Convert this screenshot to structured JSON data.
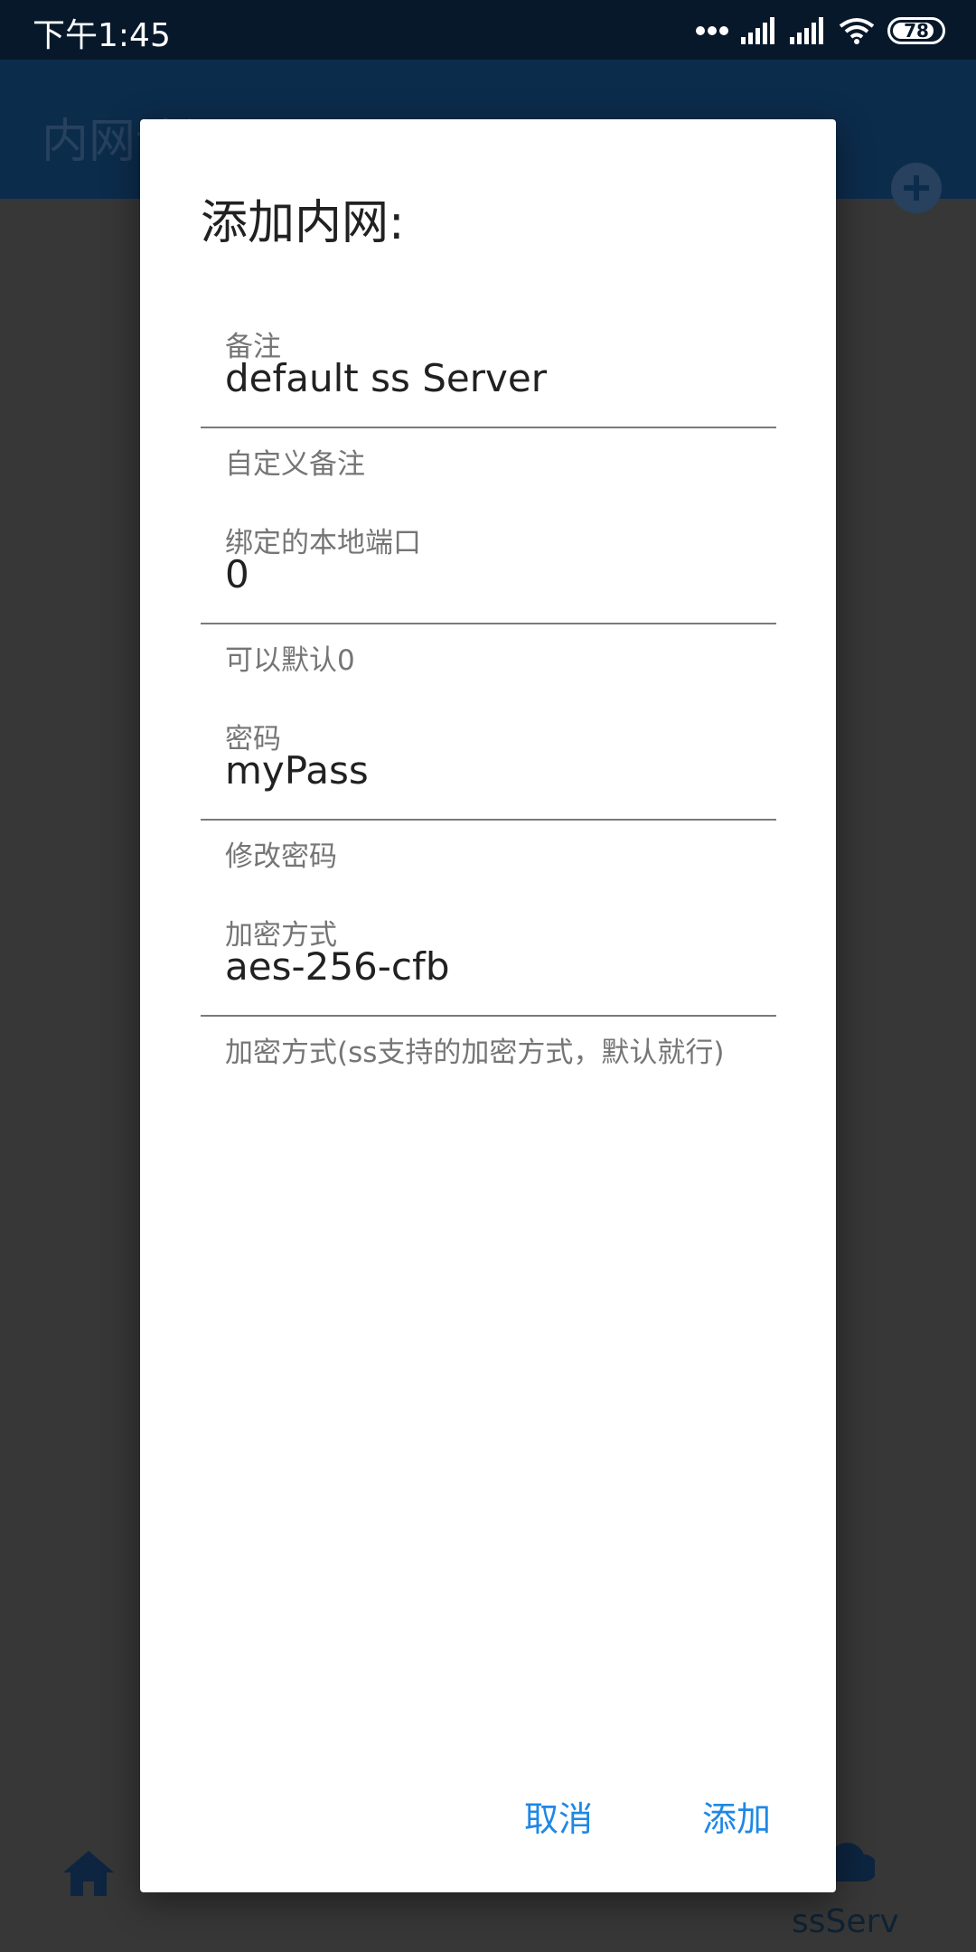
{
  "status_bar": {
    "time": "下午1:45",
    "battery_level": "78"
  },
  "app_bar": {
    "title": "内网访问工具",
    "refresh_icon": "refresh-icon",
    "add_icon": "add-circle-icon"
  },
  "dialog": {
    "title": "添加内网:",
    "fields": [
      {
        "label": "备注",
        "value": "default ss Server",
        "helper": "自定义备注"
      },
      {
        "label": "绑定的本地端口",
        "value": "0",
        "helper": "可以默认0"
      },
      {
        "label": "密码",
        "value": "myPass",
        "helper": "修改密码"
      },
      {
        "label": "加密方式",
        "value": "aes-256-cfb",
        "helper": "加密方式(ss支持的加密方式，默认就行)"
      }
    ],
    "cancel_label": "取消",
    "add_label": "添加"
  },
  "bottom_nav": {
    "active_label": "ssServ",
    "icons": [
      "home-icon",
      "cloud-icon"
    ]
  },
  "colors": {
    "status_bar": "#07182a",
    "app_bar": "#0c2c4c",
    "scrim": "#373737",
    "accent": "#1e88e5"
  }
}
